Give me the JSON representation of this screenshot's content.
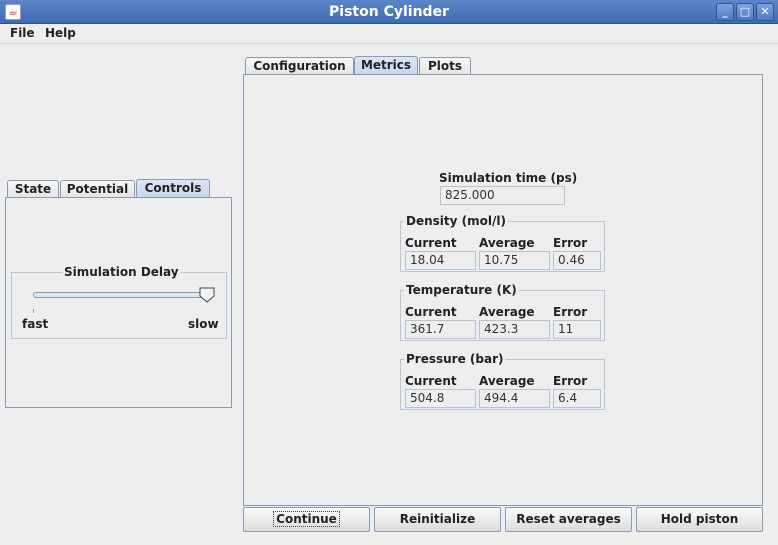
{
  "window": {
    "title": "Piston Cylinder",
    "app_icon": "java-icon"
  },
  "menu": [
    "File",
    "Help"
  ],
  "left_tabs": [
    "State",
    "Potential",
    "Controls"
  ],
  "left_active_tab": "Controls",
  "controls": {
    "delay_title": "Simulation Delay",
    "fast_label": "fast",
    "slow_label": "slow",
    "delay_level": 1.0
  },
  "right_tabs": [
    "Configuration",
    "Metrics",
    "Plots"
  ],
  "right_active_tab": "Metrics",
  "metrics": {
    "sim_time_label": "Simulation time (ps)",
    "sim_time_value": "825.000",
    "col_current": "Current",
    "col_average": "Average",
    "col_error": "Error",
    "groups": [
      {
        "title": "Density (mol/l)",
        "current": "18.04",
        "average": "10.75",
        "error": "0.46"
      },
      {
        "title": "Temperature (K)",
        "current": "361.7",
        "average": "423.3",
        "error": "11"
      },
      {
        "title": "Pressure (bar)",
        "current": "504.8",
        "average": "494.4",
        "error": "6.4"
      }
    ]
  },
  "buttons": {
    "continue": "Continue",
    "reinitialize": "Reinitialize",
    "reset_averages": "Reset averages",
    "hold_piston": "Hold piston"
  }
}
